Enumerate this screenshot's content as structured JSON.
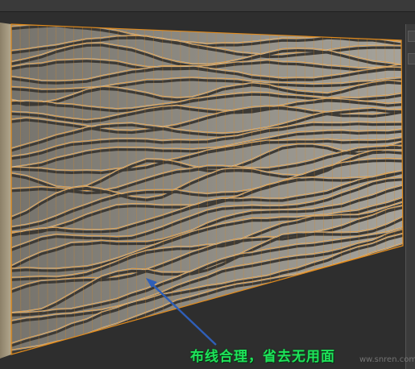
{
  "viewport": {
    "label": "",
    "wireframe_color": "#e08a1c",
    "surface_color": "#8f8c84",
    "background_color": "#2e2e2e"
  },
  "annotation": {
    "caption": "布线合理，省去无用面",
    "caption_color": "#1ee35a",
    "arrow_color": "#2f5fb8"
  },
  "watermark": {
    "text": "ww.snren.com"
  }
}
